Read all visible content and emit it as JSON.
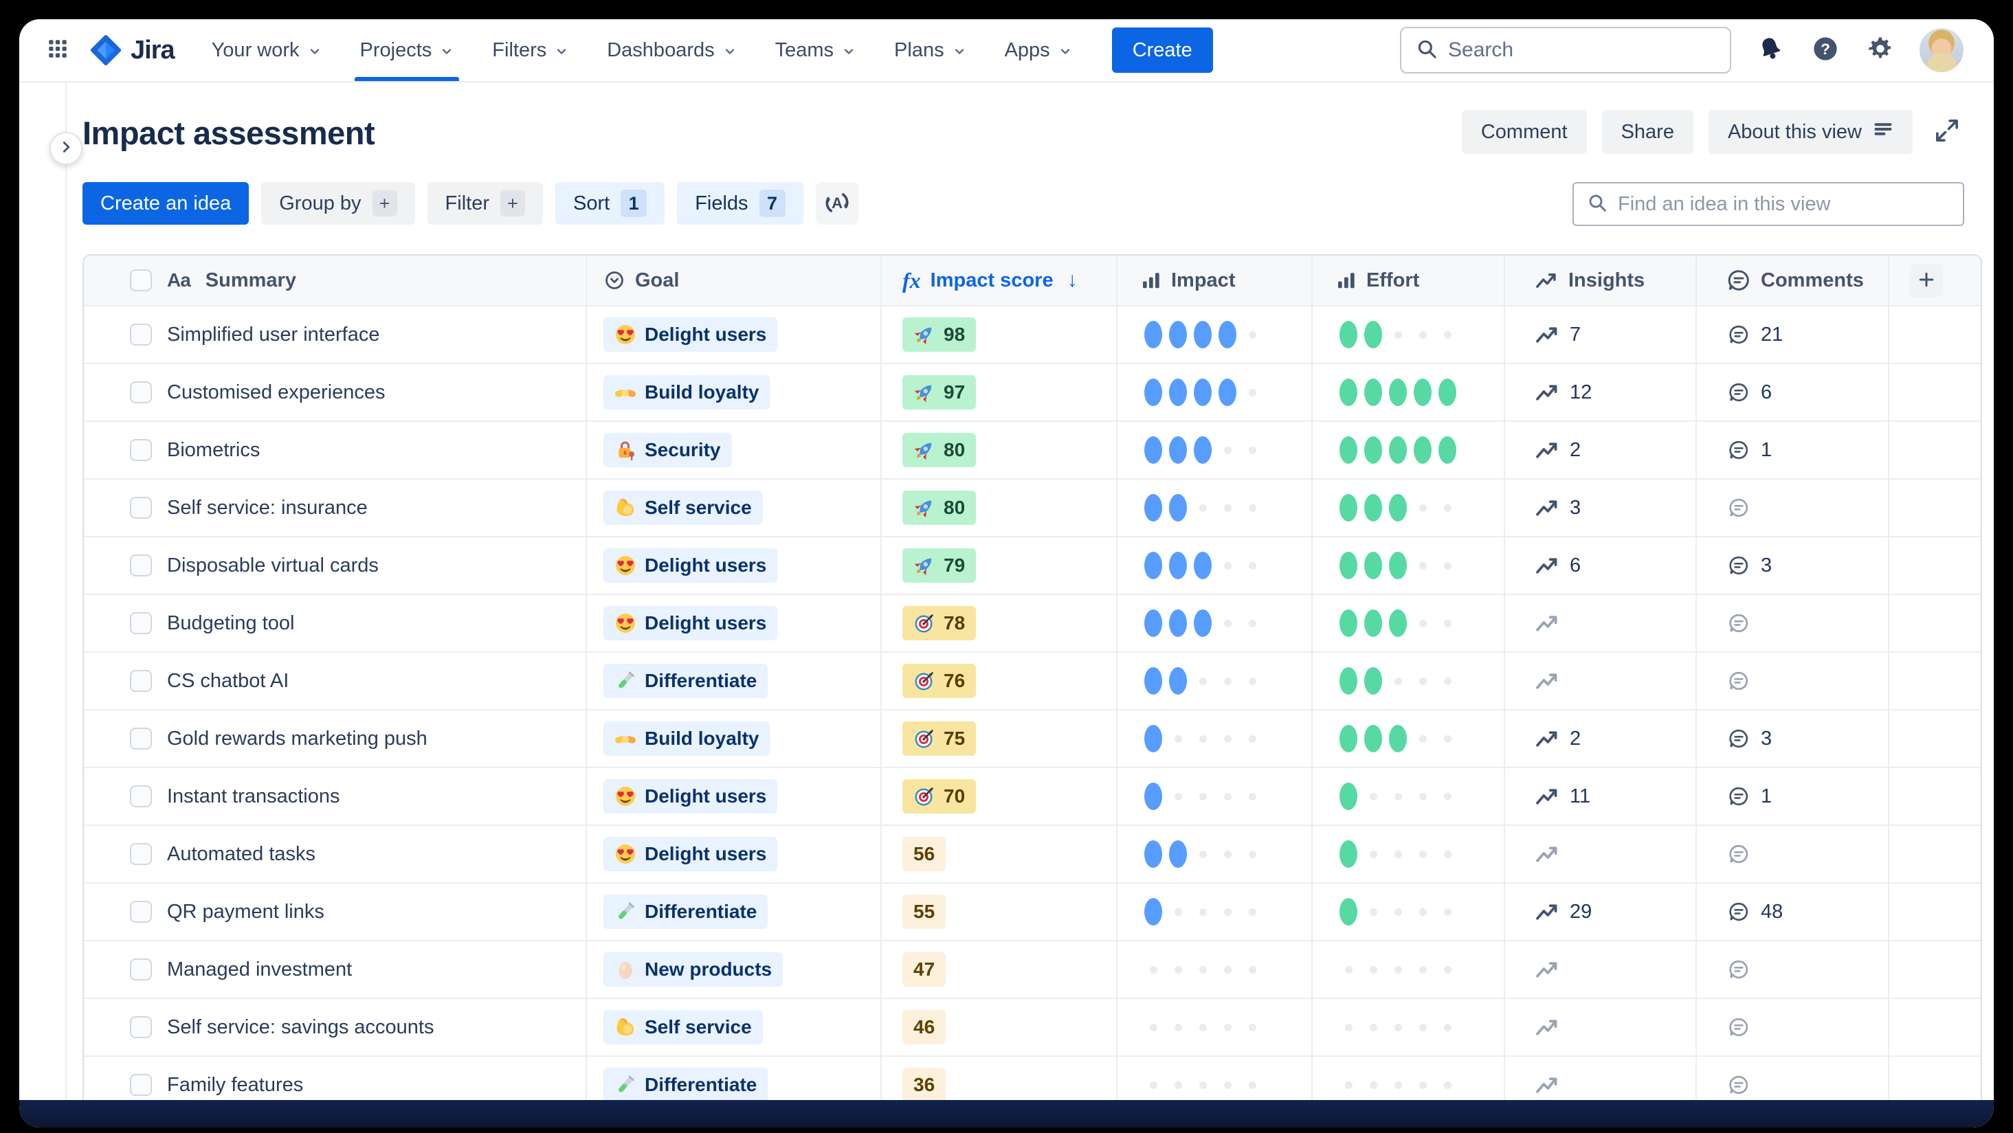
{
  "nav": {
    "logo": "Jira",
    "items": [
      {
        "label": "Your work",
        "active": false
      },
      {
        "label": "Projects",
        "active": true
      },
      {
        "label": "Filters",
        "active": false
      },
      {
        "label": "Dashboards",
        "active": false
      },
      {
        "label": "Teams",
        "active": false
      },
      {
        "label": "Plans",
        "active": false
      },
      {
        "label": "Apps",
        "active": false
      }
    ],
    "create_button": "Create",
    "search": {
      "placeholder": "Search"
    }
  },
  "view_header": {
    "title": "Impact assessment",
    "comment_button": "Comment",
    "share_button": "Share",
    "about_button": "About this view"
  },
  "toolbar": {
    "create_idea_button": "Create an idea",
    "group_by_button": "Group by",
    "filter_button": "Filter",
    "sort_button": {
      "label": "Sort",
      "count": "1"
    },
    "fields_button": {
      "label": "Fields",
      "count": "7"
    },
    "find_input_placeholder": "Find an idea in this view"
  },
  "table": {
    "columns": {
      "summary": "Summary",
      "goal": "Goal",
      "impact_score": "Impact score",
      "impact": "Impact",
      "effort": "Effort",
      "insights": "Insights",
      "comments": "Comments"
    },
    "dot_scale_max": 5,
    "rows": [
      {
        "summary": "Simplified user interface",
        "goal": {
          "icon": "heart-eyes",
          "label": "Delight users"
        },
        "score": {
          "value": "98",
          "tier": "high",
          "icon": "rocket"
        },
        "impact": 4,
        "effort": 2,
        "insights": "7",
        "comments": "21"
      },
      {
        "summary": "Customised experiences",
        "goal": {
          "icon": "handshake",
          "label": "Build loyalty"
        },
        "score": {
          "value": "97",
          "tier": "high",
          "icon": "rocket"
        },
        "impact": 4,
        "effort": 5,
        "insights": "12",
        "comments": "6"
      },
      {
        "summary": "Biometrics",
        "goal": {
          "icon": "locked-with-key",
          "label": "Security"
        },
        "score": {
          "value": "80",
          "tier": "high",
          "icon": "rocket"
        },
        "impact": 3,
        "effort": 5,
        "insights": "2",
        "comments": "1"
      },
      {
        "summary": "Self service: insurance",
        "goal": {
          "icon": "flexed-biceps",
          "label": "Self service"
        },
        "score": {
          "value": "80",
          "tier": "high",
          "icon": "rocket"
        },
        "impact": 2,
        "effort": 3,
        "insights": "3",
        "comments": ""
      },
      {
        "summary": "Disposable virtual cards",
        "goal": {
          "icon": "heart-eyes",
          "label": "Delight users"
        },
        "score": {
          "value": "79",
          "tier": "high",
          "icon": "rocket"
        },
        "impact": 3,
        "effort": 3,
        "insights": "6",
        "comments": "3"
      },
      {
        "summary": "Budgeting tool",
        "goal": {
          "icon": "heart-eyes",
          "label": "Delight users"
        },
        "score": {
          "value": "78",
          "tier": "medium",
          "icon": "dart"
        },
        "impact": 3,
        "effort": 3,
        "insights": "",
        "comments": ""
      },
      {
        "summary": "CS chatbot AI",
        "goal": {
          "icon": "test-tube",
          "label": "Differentiate"
        },
        "score": {
          "value": "76",
          "tier": "medium",
          "icon": "dart"
        },
        "impact": 2,
        "effort": 2,
        "insights": "",
        "comments": ""
      },
      {
        "summary": "Gold rewards marketing push",
        "goal": {
          "icon": "handshake",
          "label": "Build loyalty"
        },
        "score": {
          "value": "75",
          "tier": "medium",
          "icon": "dart"
        },
        "impact": 1,
        "effort": 3,
        "insights": "2",
        "comments": "3"
      },
      {
        "summary": "Instant transactions",
        "goal": {
          "icon": "heart-eyes",
          "label": "Delight users"
        },
        "score": {
          "value": "70",
          "tier": "medium",
          "icon": "dart"
        },
        "impact": 1,
        "effort": 1,
        "insights": "11",
        "comments": "1"
      },
      {
        "summary": "Automated tasks",
        "goal": {
          "icon": "heart-eyes",
          "label": "Delight users"
        },
        "score": {
          "value": "56",
          "tier": "low",
          "icon": ""
        },
        "impact": 2,
        "effort": 1,
        "insights": "",
        "comments": ""
      },
      {
        "summary": "QR payment links",
        "goal": {
          "icon": "test-tube",
          "label": "Differentiate"
        },
        "score": {
          "value": "55",
          "tier": "low",
          "icon": ""
        },
        "impact": 1,
        "effort": 1,
        "insights": "29",
        "comments": "48"
      },
      {
        "summary": "Managed investment",
        "goal": {
          "icon": "egg",
          "label": "New products"
        },
        "score": {
          "value": "47",
          "tier": "low",
          "icon": ""
        },
        "impact": 0,
        "effort": 0,
        "insights": "",
        "comments": ""
      },
      {
        "summary": "Self service: savings accounts",
        "goal": {
          "icon": "flexed-biceps",
          "label": "Self service"
        },
        "score": {
          "value": "46",
          "tier": "low",
          "icon": ""
        },
        "impact": 0,
        "effort": 0,
        "insights": "",
        "comments": ""
      },
      {
        "summary": "Family features",
        "goal": {
          "icon": "test-tube",
          "label": "Differentiate"
        },
        "score": {
          "value": "36",
          "tier": "low",
          "icon": ""
        },
        "impact": 0,
        "effort": 0,
        "insights": "",
        "comments": ""
      }
    ]
  },
  "colors": {
    "accent_blue": "#0C66E4",
    "impact_dot": "#579DFF",
    "effort_dot": "#57D9A3",
    "score_high_bg": "#B9F2CF",
    "score_medium_bg": "#F8E6A0",
    "score_low_bg": "#FDF0DC",
    "goal_chip_bg": "#E9F2FF",
    "goal_chip_text": "#09326C"
  }
}
